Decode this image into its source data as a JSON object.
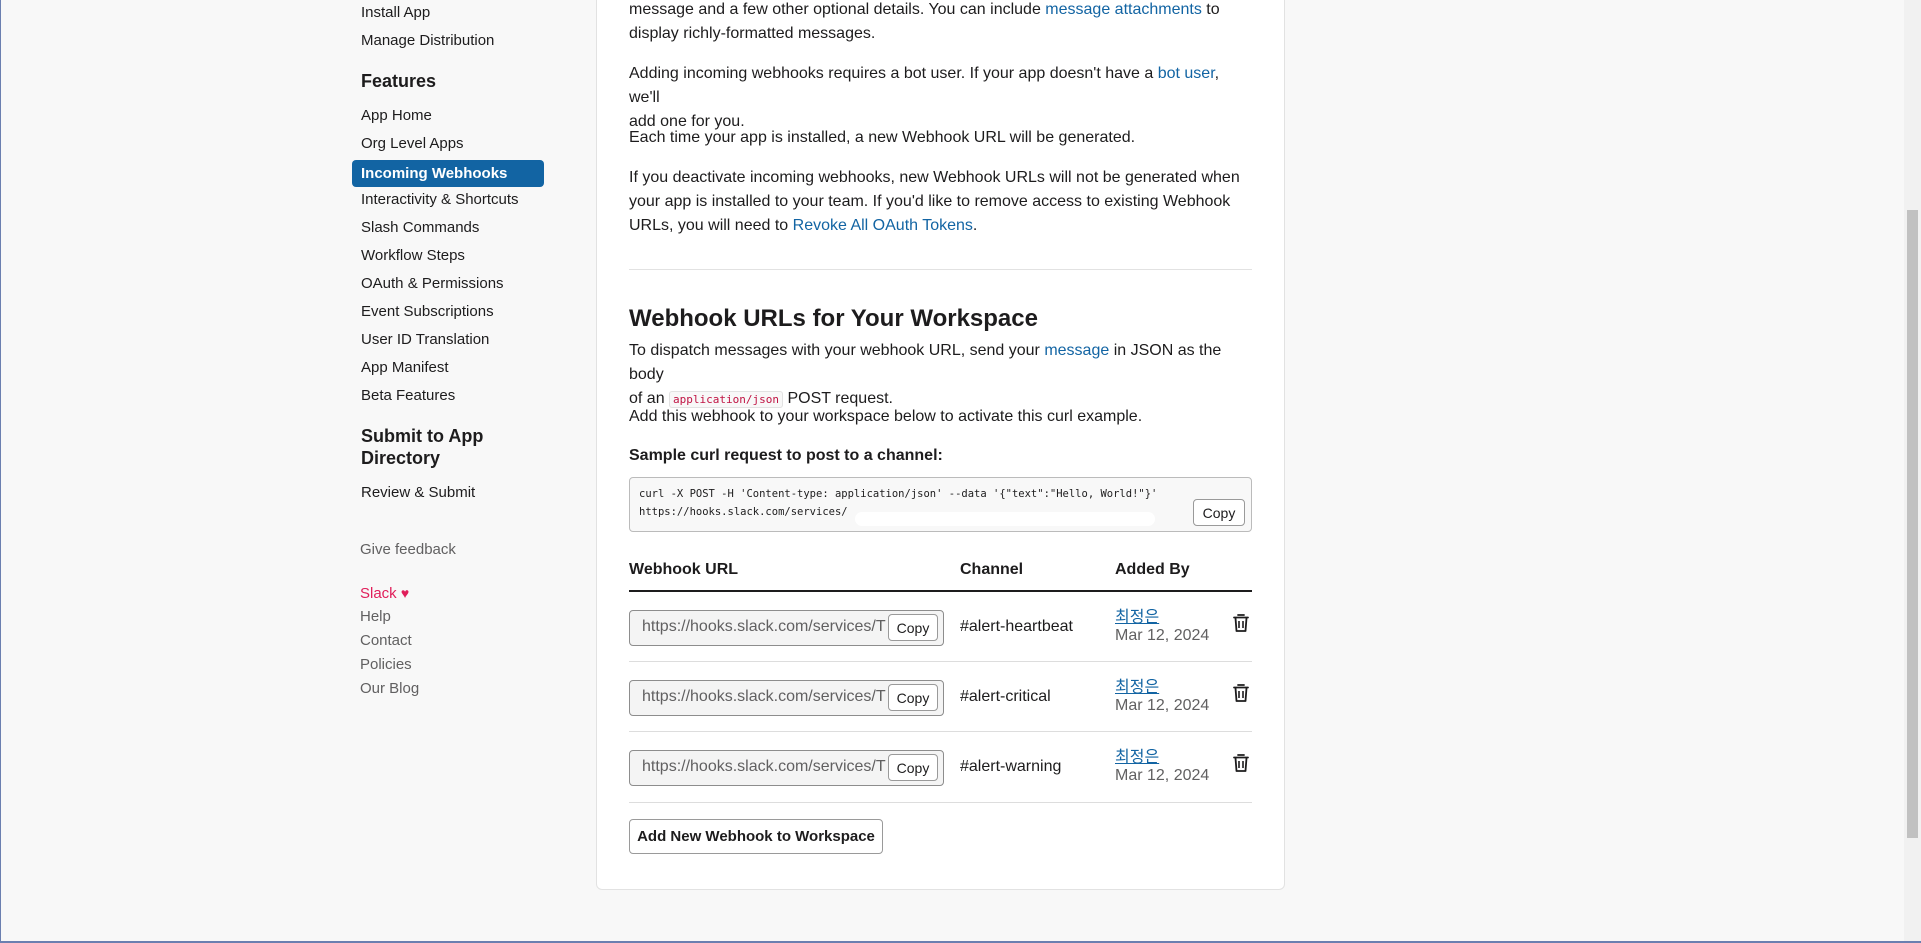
{
  "sidebar": {
    "top_items": [
      "Install App",
      "Manage Distribution"
    ],
    "features_heading": "Features",
    "features_items": [
      "App Home",
      "Org Level Apps",
      "Incoming Webhooks",
      "Interactivity & Shortcuts",
      "Slash Commands",
      "Workflow Steps",
      "OAuth & Permissions",
      "Event Subscriptions",
      "User ID Translation",
      "App Manifest",
      "Beta Features"
    ],
    "active_item": "Incoming Webhooks",
    "submit_heading_line1": "Submit to App",
    "submit_heading_line2": "Directory",
    "submit_items": [
      "Review & Submit"
    ],
    "feedback": "Give feedback",
    "footer": {
      "slack": "Slack",
      "heart": "♥",
      "help": "Help",
      "contact": "Contact",
      "policies": "Policies",
      "blog": "Our Blog"
    }
  },
  "main": {
    "p1_a": "message and a few other optional details. You can include ",
    "p1_link": "message attachments",
    "p1_b": " to",
    "p1_c": "display richly-formatted messages.",
    "p2_a": "Adding incoming webhooks requires a bot user. If your app doesn't have a ",
    "p2_link": "bot user",
    "p2_b": ", we'll",
    "p2_c": "add one for you.",
    "p3": "Each time your app is installed, a new Webhook URL will be generated.",
    "p4_a": "If you deactivate incoming webhooks, new Webhook URLs will not be generated when",
    "p4_b": "your app is installed to your team. If you'd like to remove access to existing Webhook",
    "p4_c": "URLs, you will need to ",
    "p4_link": "Revoke All OAuth Tokens",
    "p4_d": ".",
    "section_title": "Webhook URLs for Your Workspace",
    "p5_a": "To dispatch messages with your webhook URL, send your ",
    "p5_link": "message",
    "p5_b": " in JSON as the body",
    "p5_c": "of an ",
    "p5_code": "application/json",
    "p5_d": " POST request.",
    "p6": "Add this webhook to your workspace below to activate this curl example.",
    "curl_label": "Sample curl request to post to a channel:",
    "curl_line1": "curl -X POST -H 'Content-type: application/json' --data '{\"text\":\"Hello, World!\"}'",
    "curl_line2": "https://hooks.slack.com/services/",
    "copy_label": "Copy",
    "table_headers": {
      "url": "Webhook URL",
      "channel": "Channel",
      "added_by": "Added By"
    },
    "webhooks": [
      {
        "url": "https://hooks.slack.com/services/T",
        "channel": "#alert-heartbeat",
        "added_by": "최정은",
        "date": "Mar 12, 2024"
      },
      {
        "url": "https://hooks.slack.com/services/T",
        "channel": "#alert-critical",
        "added_by": "최정은",
        "date": "Mar 12, 2024"
      },
      {
        "url": "https://hooks.slack.com/services/T",
        "channel": "#alert-warning",
        "added_by": "최정은",
        "date": "Mar 12, 2024"
      }
    ],
    "add_button": "Add New Webhook to Workspace"
  }
}
